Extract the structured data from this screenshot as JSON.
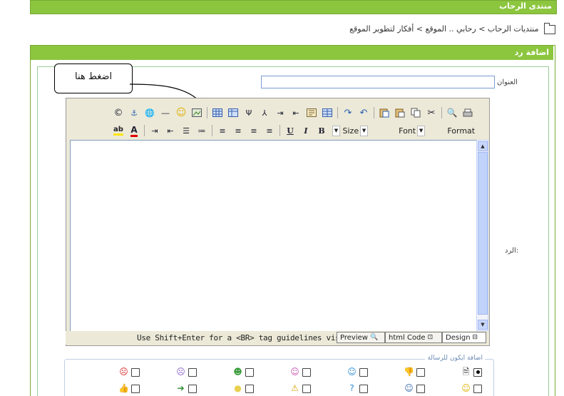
{
  "forum": {
    "title": "منتدى الرحاب"
  },
  "breadcrumb": {
    "text": "منتديات الرحاب > رحابي .. الموقع > أفكار لتطوير الموقع"
  },
  "reply_panel": {
    "title": "اضافة رد"
  },
  "form": {
    "title_label": "العنوان",
    "title_value": "",
    "reply_label": "الرد:"
  },
  "callout": {
    "text": "اضغط هنا"
  },
  "toolbar": {
    "size_label": "Size",
    "font_label": "Font",
    "format_label": "Format",
    "row1_icons": [
      "print-icon",
      "find-icon",
      "cut-icon",
      "copy-icon",
      "paste-icon",
      "paste-word-icon",
      "undo-icon",
      "redo-icon",
      "table-icon",
      "table-props-icon",
      "insert-row-icon",
      "insert-col-icon",
      "merge-cells-icon",
      "split-cells-icon",
      "delete-col-icon",
      "delete-row-icon",
      "image-icon",
      "smiley-icon",
      "horizontal-rule-icon",
      "web-link-icon",
      "anchor-icon",
      "copyright-icon"
    ],
    "row2_icons": [
      "bold-icon",
      "italic-icon",
      "underline-icon",
      "justify-left-icon",
      "justify-center-icon",
      "justify-right-icon",
      "justify-full-icon",
      "numbered-list-icon",
      "bullet-list-icon",
      "outdent-icon",
      "indent-icon",
      "font-color-icon",
      "highlight-color-icon"
    ]
  },
  "status": {
    "hint": "Use Shift+Enter for a <BR> tag  guidelines visible",
    "preview": "Preview",
    "html_code": "html Code",
    "design": "Design"
  },
  "message_icons": {
    "legend": "اضافة ايكون للرسالة",
    "row1": [
      "document-icon",
      "thumbs-down-icon",
      "smile-icon",
      "wink-icon",
      "grin-icon",
      "angry-purple-icon",
      "angry-icon"
    ],
    "row2": [
      "happy-icon",
      "cool-icon",
      "question-icon",
      "warning-icon",
      "lightbulb-icon",
      "arrow-right-icon",
      "thumbs-up-icon"
    ],
    "selected_index": 0
  },
  "colors": {
    "accent": "#8cc63f",
    "border": "#77aa33"
  }
}
